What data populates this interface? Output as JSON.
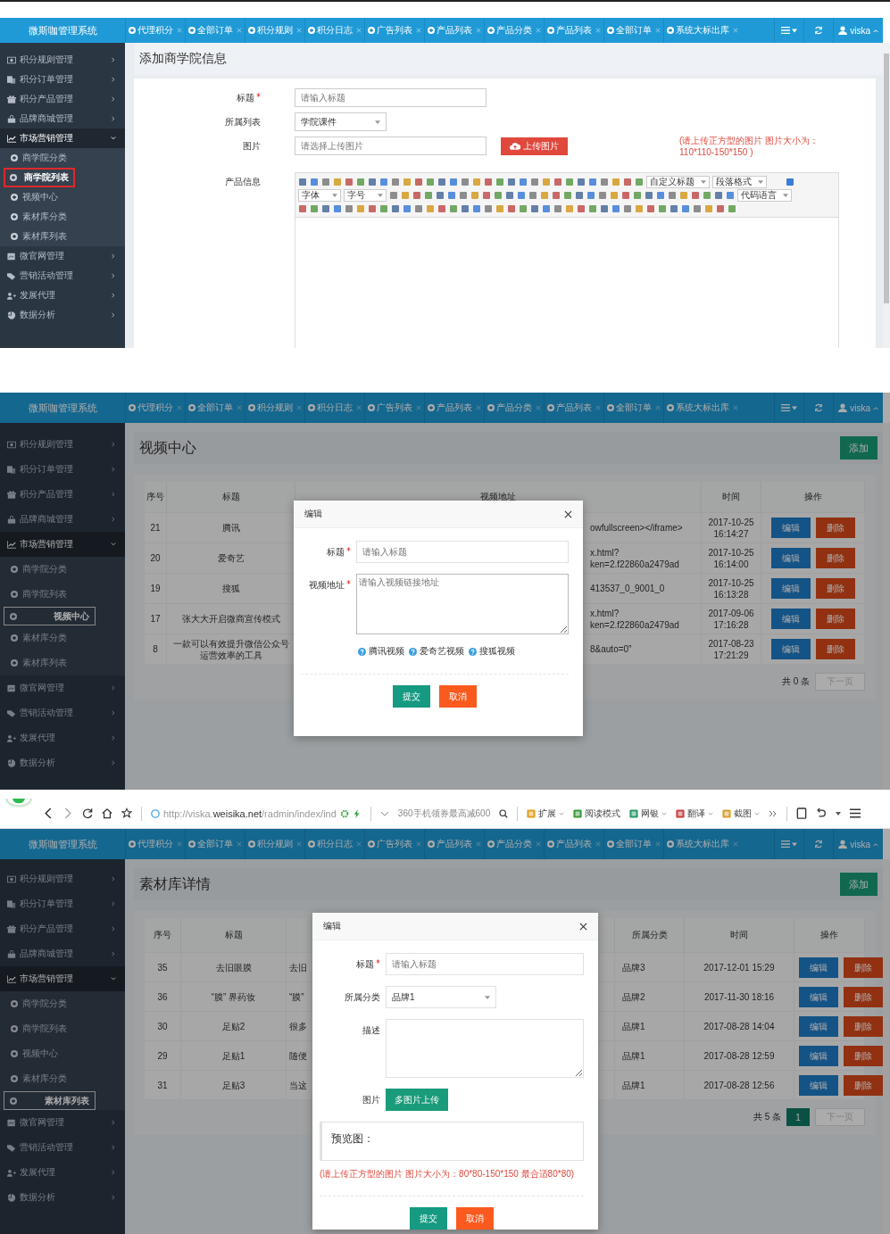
{
  "screens": [
    {
      "kind": "form_page",
      "brand": "微斯咖管理系统",
      "tabs": [
        {
          "label": "代理积分"
        },
        {
          "label": "全部订单"
        },
        {
          "label": "积分规则"
        },
        {
          "label": "积分日志"
        },
        {
          "label": "广告列表"
        },
        {
          "label": "产品列表"
        },
        {
          "label": "产品分类"
        },
        {
          "label": "产品列表"
        },
        {
          "label": "全部订单"
        },
        {
          "label": "系统大标出库"
        }
      ],
      "user": "viska",
      "sidebar": [
        {
          "label": "积分规则管理",
          "expanded": false
        },
        {
          "label": "积分订单管理",
          "expanded": false
        },
        {
          "label": "积分产品管理",
          "expanded": false
        },
        {
          "label": "品牌商城管理",
          "expanded": false
        },
        {
          "label": "市场营销管理",
          "expanded": true,
          "children": [
            {
              "label": "商学院分类",
              "selected": false,
              "annotated": false
            },
            {
              "label": "商学院列表",
              "selected": true,
              "annotated": true
            },
            {
              "label": "视频中心",
              "selected": false,
              "annotated": false
            },
            {
              "label": "素材库分类",
              "selected": false,
              "annotated": false
            },
            {
              "label": "素材库列表",
              "selected": false,
              "annotated": false
            }
          ]
        },
        {
          "label": "微官网管理",
          "expanded": false
        },
        {
          "label": "营销活动管理",
          "expanded": false
        },
        {
          "label": "发展代理",
          "expanded": false
        },
        {
          "label": "数据分析",
          "expanded": false
        }
      ],
      "page_title": "添加商学院信息",
      "form": [
        {
          "kind": "text",
          "label": "标题",
          "required": true,
          "placeholder": "请输入标题"
        },
        {
          "kind": "select",
          "label": "所属列表",
          "required": false,
          "value": "学院课件"
        },
        {
          "kind": "upload",
          "label": "图片",
          "required": false,
          "placeholder": "请选择上传图片",
          "button": "上传图片",
          "hint": "(请上传正方型的图片 图片大小为：110*110-150*150 )"
        },
        {
          "kind": "editor",
          "label": "产品信息",
          "required": false,
          "toolbar_selects": [
            "自定义标题",
            "段落格式",
            "字体",
            "字号",
            "代码语言"
          ]
        }
      ]
    },
    {
      "kind": "video_list",
      "brand": "微斯咖管理系统",
      "tabs": [
        {
          "label": "代理积分"
        },
        {
          "label": "全部订单"
        },
        {
          "label": "积分规则"
        },
        {
          "label": "积分日志"
        },
        {
          "label": "广告列表"
        },
        {
          "label": "产品列表"
        },
        {
          "label": "产品分类"
        },
        {
          "label": "产品列表"
        },
        {
          "label": "全部订单"
        },
        {
          "label": "系统大标出库"
        }
      ],
      "user": "viska",
      "sidebar": [
        {
          "label": "积分规则管理",
          "expanded": false
        },
        {
          "label": "积分订单管理",
          "expanded": false
        },
        {
          "label": "积分产品管理",
          "expanded": false
        },
        {
          "label": "品牌商城管理",
          "expanded": false
        },
        {
          "label": "市场营销管理",
          "expanded": true,
          "children": [
            {
              "label": "商学院分类",
              "selected": false,
              "annotated": false
            },
            {
              "label": "商学院列表",
              "selected": false,
              "annotated": false
            },
            {
              "label": "视频中心",
              "selected": true,
              "annotated": false
            },
            {
              "label": "素材库分类",
              "selected": false,
              "annotated": false
            },
            {
              "label": "素材库列表",
              "selected": false,
              "annotated": false
            }
          ]
        },
        {
          "label": "微官网管理",
          "expanded": false
        },
        {
          "label": "营销活动管理",
          "expanded": false
        },
        {
          "label": "发展代理",
          "expanded": false
        },
        {
          "label": "数据分析",
          "expanded": false
        }
      ],
      "page_title": "视频中心",
      "add_button": "添加",
      "table": {
        "columns": [
          "序号",
          "标题",
          "视频地址",
          "时间",
          "操作"
        ],
        "rows": [
          {
            "cells": [
              [
                "21"
              ],
              [
                "腾讯"
              ],
              [
                "owfullscreen></iframe>"
              ],
              [
                "2017-10-25",
                "16:14:27"
              ]
            ],
            "actions": [
              "编辑",
              "删除"
            ]
          },
          {
            "cells": [
              [
                "20"
              ],
              [
                "爱奇艺"
              ],
              [
                "x.html?",
                "ken=2.f22860a2479ad"
              ],
              [
                "2017-10-25",
                "16:14:00"
              ]
            ],
            "actions": [
              "编辑",
              "删除"
            ]
          },
          {
            "cells": [
              [
                "19"
              ],
              [
                "搜狐"
              ],
              [
                "413537_0_9001_0"
              ],
              [
                "2017-10-25",
                "16:13:28"
              ]
            ],
            "actions": [
              "编辑",
              "删除"
            ]
          },
          {
            "cells": [
              [
                "17"
              ],
              [
                "张大大开启微商宣传模式"
              ],
              [
                "x.html?",
                "ken=2.f22860a2479ad"
              ],
              [
                "2017-09-06",
                "17:16:28"
              ]
            ],
            "actions": [
              "编辑",
              "删除"
            ]
          },
          {
            "cells": [
              [
                "8"
              ],
              [
                "一款可以有效提升微信公众号",
                "运营效率的工具"
              ],
              [
                "8&auto=0\""
              ],
              [
                "2017-08-23",
                "17:21:29"
              ]
            ],
            "actions": [
              "编辑",
              "删除"
            ]
          }
        ]
      },
      "pager": {
        "total": "共 0 条",
        "next": "下一页",
        "next_disabled": true
      },
      "modal": {
        "title": "编辑",
        "fields": [
          {
            "kind": "text",
            "label": "标题",
            "required": true,
            "placeholder": "请输入标题"
          },
          {
            "kind": "textarea",
            "label": "视频地址",
            "required": true,
            "placeholder": "请输入视频链接地址"
          },
          {
            "kind": "help",
            "items": [
              "腾讯视频",
              "爱奇艺视频",
              "搜狐视频"
            ]
          }
        ],
        "buttons": [
          {
            "label": "提交",
            "kind": "primary"
          },
          {
            "label": "取消",
            "kind": "cancel"
          }
        ]
      }
    },
    {
      "kind": "material_list",
      "browser": {
        "url": "http://viska.**weisika.net**/radmin/index/ind",
        "search": "360手机领券最高减600",
        "tools": [
          {
            "label": "扩展",
            "dropdown": true
          },
          {
            "label": "阅读模式",
            "dropdown": false
          },
          {
            "label": "网银",
            "dropdown": true
          },
          {
            "label": "翻译",
            "dropdown": true
          },
          {
            "label": "截图",
            "dropdown": true
          }
        ]
      },
      "brand": "微斯咖管理系统",
      "tabs": [
        {
          "label": "代理积分"
        },
        {
          "label": "全部订单"
        },
        {
          "label": "积分规则"
        },
        {
          "label": "积分日志"
        },
        {
          "label": "广告列表"
        },
        {
          "label": "产品列表"
        },
        {
          "label": "产品分类"
        },
        {
          "label": "产品列表"
        },
        {
          "label": "全部订单"
        },
        {
          "label": "系统大标出库"
        }
      ],
      "user": "viska",
      "sidebar": [
        {
          "label": "积分规则管理",
          "expanded": false
        },
        {
          "label": "积分订单管理",
          "expanded": false
        },
        {
          "label": "积分产品管理",
          "expanded": false
        },
        {
          "label": "品牌商城管理",
          "expanded": false
        },
        {
          "label": "市场营销管理",
          "expanded": true,
          "children": [
            {
              "label": "商学院分类",
              "selected": false,
              "annotated": false
            },
            {
              "label": "商学院列表",
              "selected": false,
              "annotated": false
            },
            {
              "label": "视频中心",
              "selected": false,
              "annotated": false
            },
            {
              "label": "素材库分类",
              "selected": false,
              "annotated": false
            },
            {
              "label": "素材库列表",
              "selected": true,
              "annotated": false
            }
          ]
        },
        {
          "label": "微官网管理",
          "expanded": false
        },
        {
          "label": "营销活动管理",
          "expanded": false
        },
        {
          "label": "发展代理",
          "expanded": false
        },
        {
          "label": "数据分析",
          "expanded": false
        }
      ],
      "page_title": "素材库详情",
      "add_button": "添加",
      "table": {
        "columns": [
          "序号",
          "标题",
          "",
          "所属分类",
          "时间",
          "操作"
        ],
        "rows": [
          {
            "cells": [
              [
                "35"
              ],
              [
                "去旧眼膜"
              ],
              [
                "去旧"
              ],
              [
                "品牌3"
              ],
              [
                "2017-12-01 15:29"
              ]
            ],
            "actions": [
              "编辑",
              "删除"
            ]
          },
          {
            "cells": [
              [
                "36"
              ],
              [
                "“膜” 界药妆"
              ],
              [
                "“膜”"
              ],
              [
                "品牌2"
              ],
              [
                "2017-11-30 18:16"
              ]
            ],
            "actions": [
              "编辑",
              "删除"
            ]
          },
          {
            "cells": [
              [
                "30"
              ],
              [
                "足贴2"
              ],
              [
                "很多"
              ],
              [
                "品牌1"
              ],
              [
                "2017-08-28 14:04"
              ]
            ],
            "actions": [
              "编辑",
              "删除"
            ]
          },
          {
            "cells": [
              [
                "29"
              ],
              [
                "足贴1"
              ],
              [
                "随便"
              ],
              [
                "品牌1"
              ],
              [
                "2017-08-28 12:59"
              ]
            ],
            "actions": [
              "编辑",
              "删除"
            ]
          },
          {
            "cells": [
              [
                "31"
              ],
              [
                "足贴3"
              ],
              [
                "当这"
              ],
              [
                "品牌1"
              ],
              [
                "2017-08-28 12:56"
              ]
            ],
            "actions": [
              "编辑",
              "删除"
            ]
          }
        ]
      },
      "pager": {
        "total": "共 5 条",
        "pages": [
          {
            "label": "1",
            "selected": true
          }
        ],
        "next": "下一页",
        "next_disabled": true
      },
      "modal": {
        "title": "编辑",
        "fields": [
          {
            "kind": "text",
            "label": "标题",
            "required": true,
            "placeholder": "请输入标题"
          },
          {
            "kind": "select",
            "label": "所属分类",
            "required": false,
            "value": "品牌1"
          },
          {
            "kind": "textarea",
            "label": "描述",
            "required": false
          },
          {
            "kind": "upload_button",
            "label": "图片",
            "required": false,
            "button": "多图片上传"
          },
          {
            "kind": "preview",
            "label": "预览图："
          },
          {
            "kind": "hint",
            "text": "(请上传正方型的图片 图片大小为：80*80-150*150 最合适80*80)"
          }
        ],
        "buttons": [
          {
            "label": "提交",
            "kind": "primary"
          },
          {
            "label": "取消",
            "kind": "cancel"
          }
        ]
      }
    }
  ]
}
